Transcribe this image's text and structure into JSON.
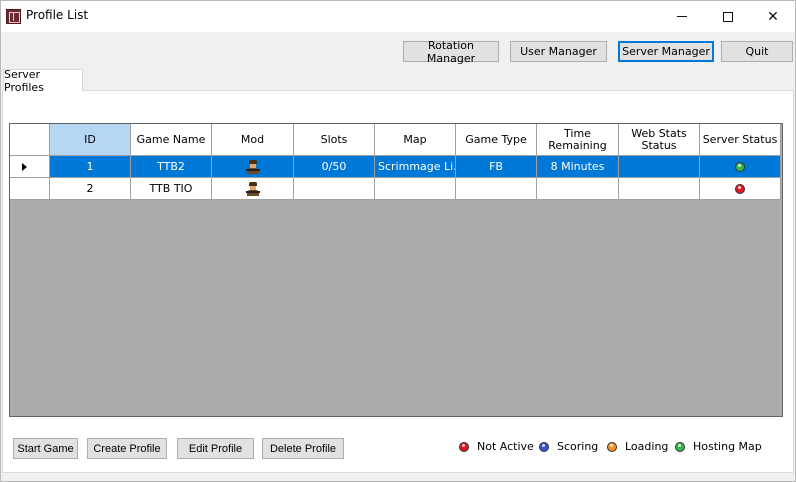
{
  "window": {
    "title": "Profile List"
  },
  "toolbar": {
    "buttons": [
      {
        "label": "Rotation Manager"
      },
      {
        "label": "User Manager"
      },
      {
        "label": "Server Manager"
      },
      {
        "label": "Quit"
      }
    ]
  },
  "tabs": [
    {
      "label": "Server Profiles",
      "selected": true
    }
  ],
  "grid": {
    "columns": [
      "ID",
      "Game Name",
      "Mod",
      "Slots",
      "Map",
      "Game Type",
      "Time Remaining",
      "Web Stats Status",
      "Server Status"
    ],
    "rows": [
      {
        "id": "1",
        "game_name": "TTB2",
        "mod_icon": "soldier-icon",
        "slots": "0/50",
        "map": "Scrimmage Li...",
        "game_type": "FB",
        "time_remaining": "8 Minutes",
        "web_stats_status": "",
        "server_status": "Hosting Map",
        "selected": true
      },
      {
        "id": "2",
        "game_name": "TTB TIO",
        "mod_icon": "soldier-icon",
        "slots": "",
        "map": "",
        "game_type": "",
        "time_remaining": "",
        "web_stats_status": "",
        "server_status": "Not Active",
        "selected": false
      }
    ]
  },
  "actions": {
    "buttons": [
      {
        "label": "Start Game"
      },
      {
        "label": "Create Profile"
      },
      {
        "label": "Edit Profile"
      },
      {
        "label": "Delete Profile"
      }
    ]
  },
  "legend": [
    {
      "label": "Not Active",
      "color": "#e81123"
    },
    {
      "label": "Scoring",
      "color": "#3a4ed6"
    },
    {
      "label": "Loading",
      "color": "#f7931e"
    },
    {
      "label": "Hosting Map",
      "color": "#2fb84a"
    }
  ],
  "colors": {
    "selection": "#0078d7",
    "grid_background": "#ababab",
    "selected_header": "#b5d7f3"
  }
}
